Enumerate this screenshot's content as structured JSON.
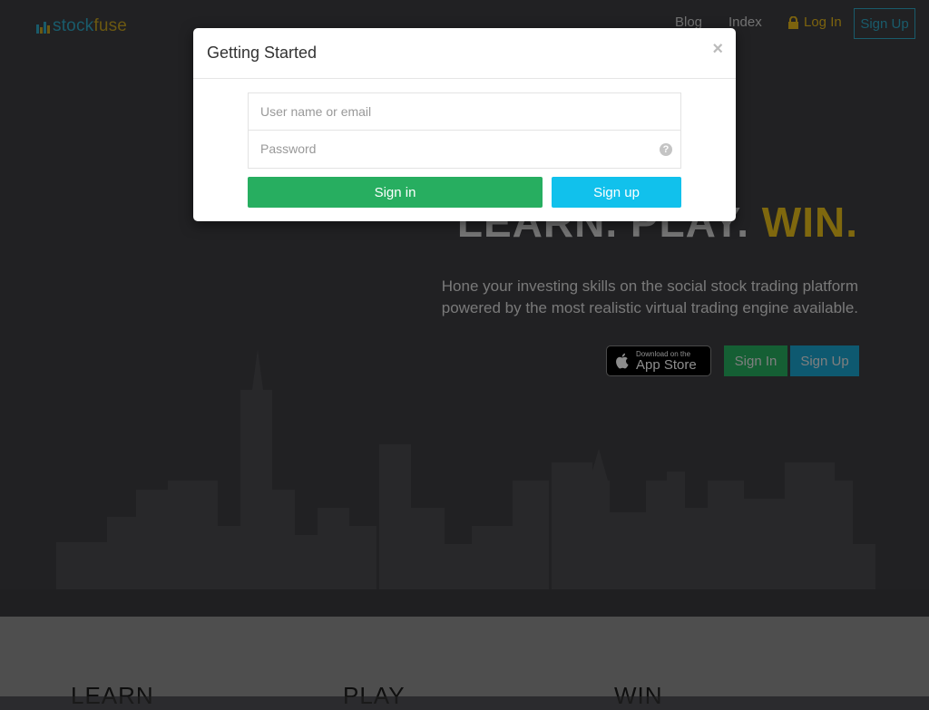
{
  "brand": {
    "part1": "stock",
    "part2": "fuse"
  },
  "nav": {
    "blog": "Blog",
    "index": "Index",
    "login": "Log In",
    "signup": "Sign Up"
  },
  "hero": {
    "headline_part1": "LEARN. PLAY. ",
    "headline_win": "WIN.",
    "tagline": "Hone your investing skills on the social stock trading platform powered by the most realistic virtual trading engine available.",
    "appstore_small": "Download on the",
    "appstore_big": "App Store",
    "signin": "Sign In",
    "signup": "Sign Up"
  },
  "sections": [
    "LEARN",
    "PLAY",
    "WIN"
  ],
  "modal": {
    "title": "Getting Started",
    "close": "×",
    "username_placeholder": "User name or email",
    "password_placeholder": "Password",
    "help": "?",
    "signin": "Sign in",
    "signup": "Sign up"
  },
  "colors": {
    "accent_blue": "#2fa6c4",
    "accent_gold": "#e8bd1a",
    "green": "#27ae60",
    "cyan": "#11c1ec"
  }
}
